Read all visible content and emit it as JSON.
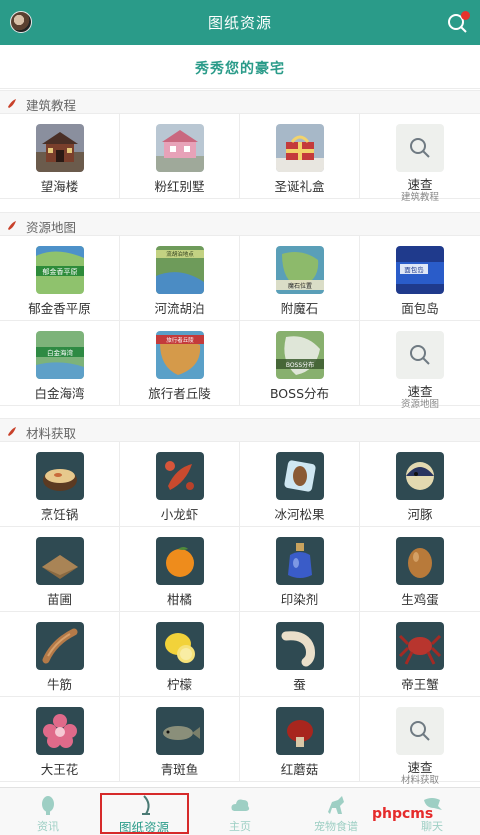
{
  "header": {
    "title": "图纸资源"
  },
  "banner": {
    "title": "秀秀您的豪宅"
  },
  "sections": [
    {
      "label": "建筑教程"
    },
    {
      "label": "资源地图"
    },
    {
      "label": "材料获取"
    }
  ],
  "architecture": [
    {
      "label": "望海楼",
      "thumb": "building-thumb"
    },
    {
      "label": "粉红别墅",
      "thumb": "villa-thumb"
    },
    {
      "label": "圣诞礼盒",
      "thumb": "christmas-thumb"
    },
    {
      "label": "速查",
      "sub": "建筑教程"
    }
  ],
  "maps": [
    {
      "label": "郁金香平原",
      "thumb": "map-thumb",
      "overlay": "郁金香平原"
    },
    {
      "label": "河流胡泊",
      "thumb": "map-thumb",
      "overlay": "流胡泊地点"
    },
    {
      "label": "附魔石",
      "thumb": "map-thumb",
      "overlay": "魔石位置"
    },
    {
      "label": "面包岛",
      "thumb": "map-thumb",
      "overlay": "面包岛"
    },
    {
      "label": "白金海湾",
      "thumb": "map-thumb",
      "overlay": "白金海湾"
    },
    {
      "label": "旅行者丘陵",
      "thumb": "map-thumb",
      "overlay": "旅行者丘陵"
    },
    {
      "label": "BOSS分布",
      "thumb": "map-thumb",
      "overlay": "BOSS分布"
    },
    {
      "label": "速查",
      "sub": "资源地图"
    }
  ],
  "materials": [
    {
      "label": "烹饪锅",
      "thumb": "pot-icon"
    },
    {
      "label": "小龙虾",
      "thumb": "crayfish-icon"
    },
    {
      "label": "冰河松果",
      "thumb": "pinecone-icon"
    },
    {
      "label": "河豚",
      "thumb": "pufferfish-icon"
    },
    {
      "label": "苗圃",
      "thumb": "nursery-icon"
    },
    {
      "label": "柑橘",
      "thumb": "orange-icon"
    },
    {
      "label": "印染剂",
      "thumb": "dye-icon"
    },
    {
      "label": "生鸡蛋",
      "thumb": "egg-icon"
    },
    {
      "label": "牛筋",
      "thumb": "tendon-icon"
    },
    {
      "label": "柠檬",
      "thumb": "lemon-icon"
    },
    {
      "label": "蚕",
      "thumb": "silkworm-icon"
    },
    {
      "label": "帝王蟹",
      "thumb": "crab-icon"
    },
    {
      "label": "大王花",
      "thumb": "flower-icon"
    },
    {
      "label": "青斑鱼",
      "thumb": "fish-icon"
    },
    {
      "label": "红蘑菇",
      "thumb": "mushroom-icon"
    },
    {
      "label": "速查",
      "sub": "材料获取"
    }
  ],
  "nav": [
    {
      "label": "资讯",
      "icon": "news-icon"
    },
    {
      "label": "图纸资源",
      "icon": "blueprint-icon"
    },
    {
      "label": "主页",
      "icon": "home-cloud-icon"
    },
    {
      "label": "宠物食谱",
      "icon": "pet-icon"
    },
    {
      "label": "聊天",
      "icon": "chat-icon"
    }
  ],
  "watermark": "phpcms",
  "colors": {
    "primary": "#2a9b89",
    "highlight": "#d62a2a",
    "section_icon": "#c8412a"
  }
}
